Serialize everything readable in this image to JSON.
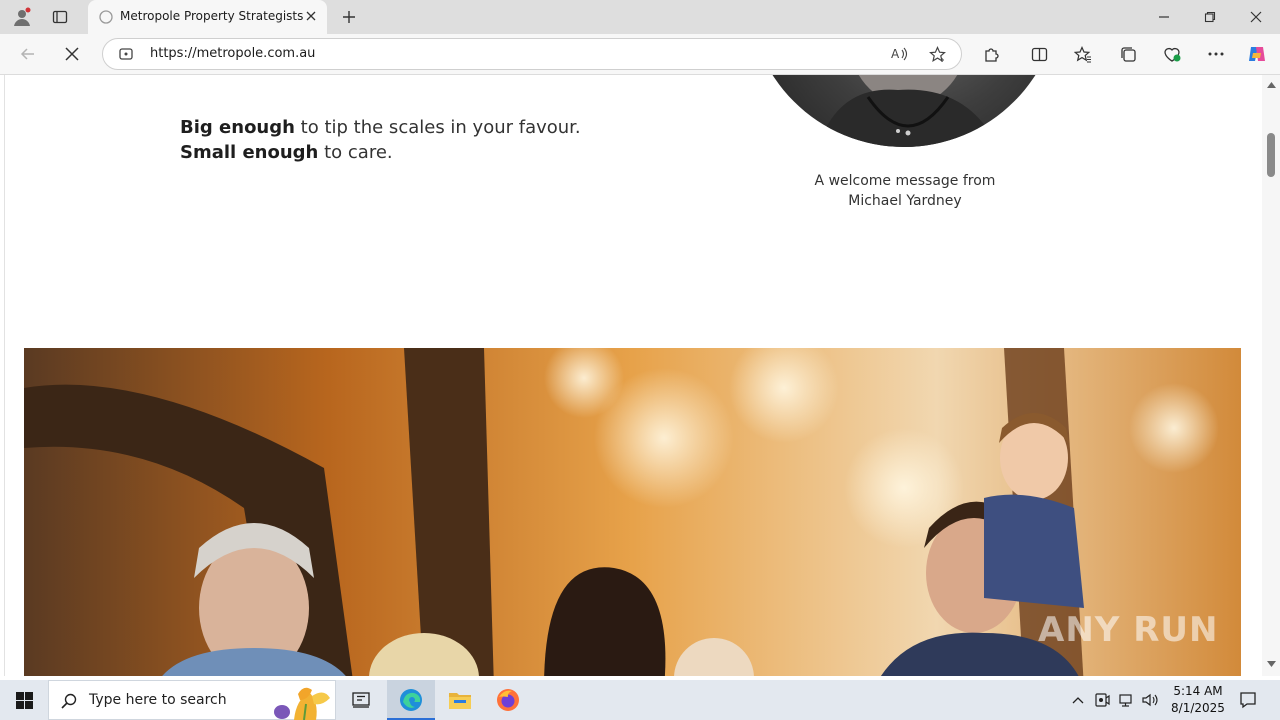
{
  "browser": {
    "tab_title": "Metropole Property Strategists | S",
    "url": "https://metropole.com.au"
  },
  "page": {
    "tagline_bold_1": "Big enough",
    "tagline_rest_1": " to tip the scales in your favour.",
    "tagline_bold_2": "Small enough",
    "tagline_rest_2": " to care.",
    "caption_line_1": "A welcome message from",
    "caption_line_2": "Michael Yardney",
    "watermark": "ANY RUN"
  },
  "taskbar": {
    "search_placeholder": "Type here to search",
    "time": "5:14 AM",
    "date": "8/1/2025"
  },
  "colors": {
    "accent": "#2b6fd6",
    "edge_icon": "#1f8fd9",
    "firefox": "#ff7139"
  }
}
